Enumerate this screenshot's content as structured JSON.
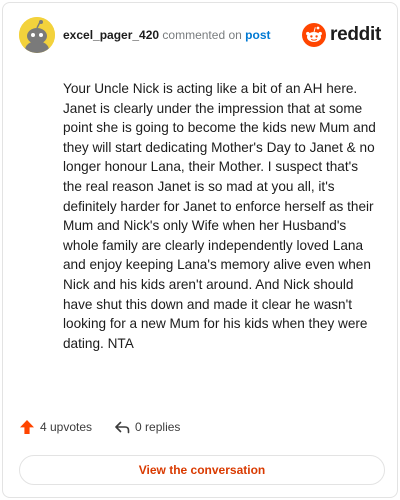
{
  "comment": {
    "username": "excel_pager_420",
    "action_text": "commented on",
    "post_link_label": "post",
    "body": "Your Uncle Nick is acting like a bit of an AH here. Janet is clearly under the impression that at some point she is going to become the kids new Mum and they will start dedicating Mother's Day to Janet & no longer honour Lana, their Mother. I suspect that's the real reason Janet is so mad at you all, it's definitely harder for Janet to enforce herself as their Mum and Nick's only Wife when her Husband's whole family are clearly independently loved Lana and enjoy keeping Lana's memory alive even when Nick and his kids aren't around. And Nick should have shut this down and made it clear he wasn't looking for a new Mum for his kids when they were dating. NTA",
    "upvotes_label": "4 upvotes",
    "replies_label": "0 replies"
  },
  "brand": {
    "logo_text": "reddit",
    "logo_icon": "reddit-snoo-icon",
    "accent_color": "#ff4500"
  },
  "cta": {
    "label": "View the conversation"
  }
}
